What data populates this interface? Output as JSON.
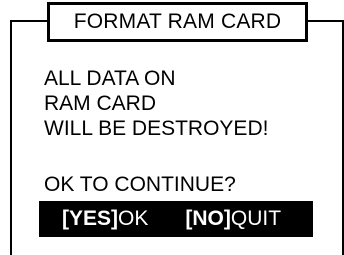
{
  "dialog": {
    "title": "FORMAT RAM CARD",
    "message": "ALL DATA ON\nRAM CARD\nWILL BE DESTROYED!",
    "prompt": "OK TO CONTINUE?",
    "softkeys": {
      "yes": {
        "key": "[YES]",
        "action": "OK"
      },
      "no": {
        "key": "[NO]",
        "action": "QUIT"
      }
    }
  }
}
